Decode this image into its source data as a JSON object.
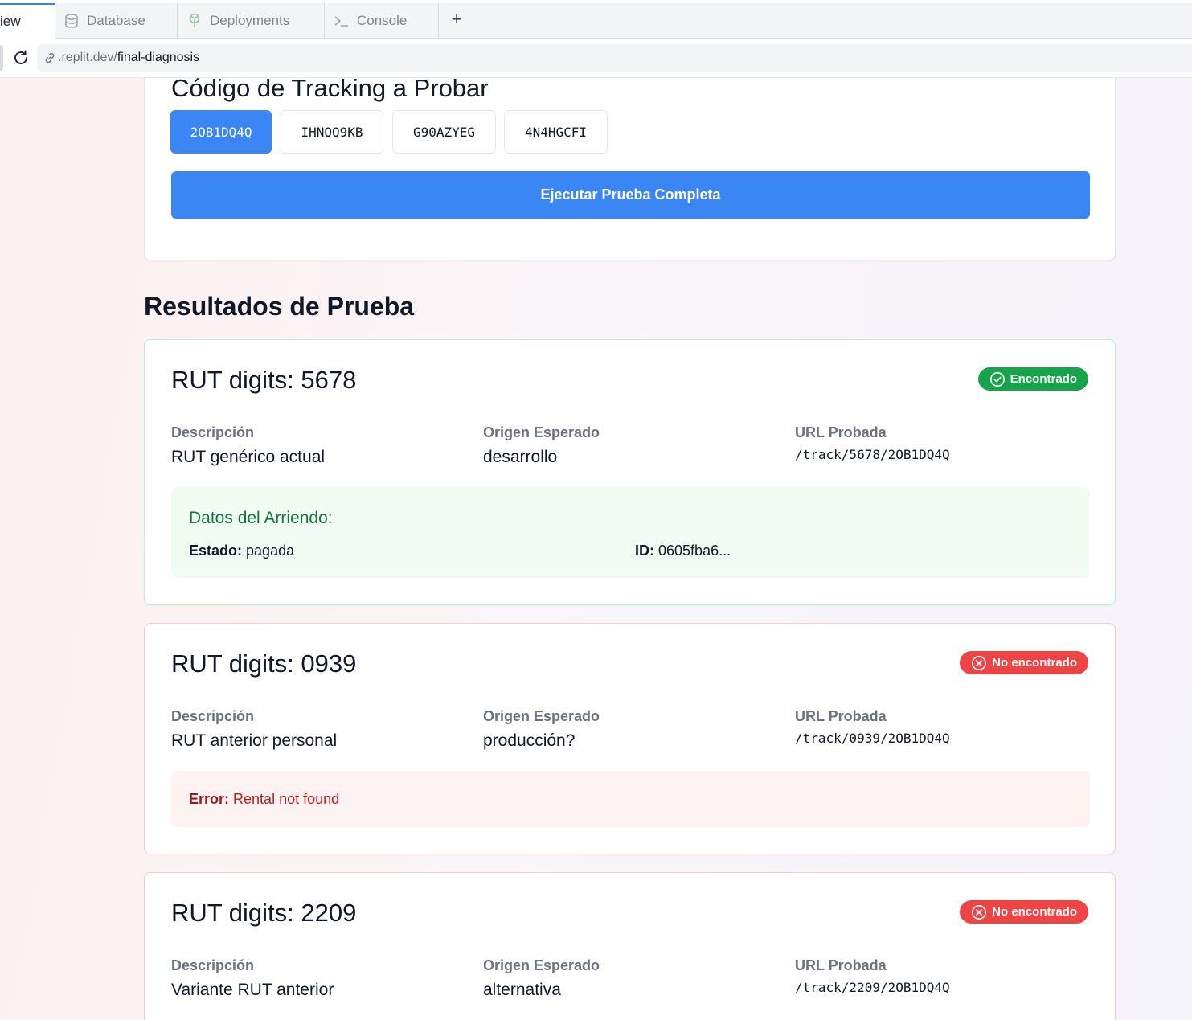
{
  "browser": {
    "tabs": [
      {
        "label": "iew",
        "icon": "preview-icon",
        "active": true
      },
      {
        "label": "Database",
        "icon": "database-icon",
        "active": false
      },
      {
        "label": "Deployments",
        "icon": "deployments-icon",
        "active": false
      },
      {
        "label": "Console",
        "icon": "console-icon",
        "active": false
      }
    ],
    "new_tab_label": "+",
    "url_prefix": ".replit.dev/",
    "url_path": "final-diagnosis"
  },
  "tracking_card": {
    "title": "Código de Tracking a Probar",
    "codes": [
      "2OB1DQ4Q",
      "IHNQQ9KB",
      "G90AZYEG",
      "4N4HGCFI"
    ],
    "selected_index": 0,
    "run_button": "Ejecutar Prueba Completa"
  },
  "results": {
    "title": "Resultados de Prueba",
    "labels": {
      "description": "Descripción",
      "origin": "Origen Esperado",
      "url": "URL Probada"
    },
    "items": [
      {
        "title": "RUT digits: 5678",
        "status": "Encontrado",
        "description": "RUT genérico actual",
        "origin": "desarrollo",
        "url": "/track/5678/2OB1DQ4Q",
        "data_title": "Datos del Arriendo:",
        "estado_label": "Estado:",
        "estado_value": "pagada",
        "id_label": "ID:",
        "id_value": "0605fba6..."
      },
      {
        "title": "RUT digits: 0939",
        "status": "No encontrado",
        "description": "RUT anterior personal",
        "origin": "producción?",
        "url": "/track/0939/2OB1DQ4Q",
        "error_label": "Error:",
        "error_message": "Rental not found"
      },
      {
        "title": "RUT digits: 2209",
        "status": "No encontrado",
        "description": "Variante RUT anterior",
        "origin": "alternativa",
        "url": "/track/2209/2OB1DQ4Q"
      }
    ]
  },
  "colors": {
    "primary": "#3b86f5",
    "success": "#16a34a",
    "danger": "#ef4444"
  }
}
